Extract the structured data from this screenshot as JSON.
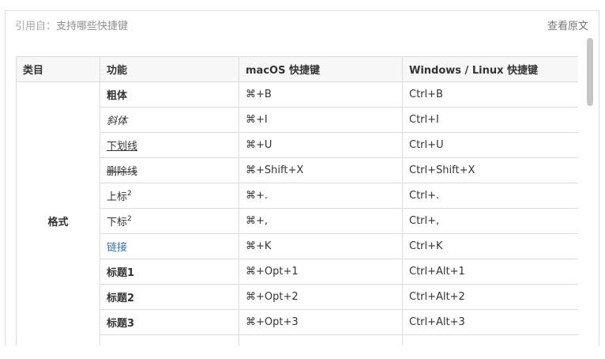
{
  "quote": {
    "prefix": "引用自：",
    "title": "支持哪些快捷键",
    "view_original": "查看原文"
  },
  "table": {
    "headers": [
      "类目",
      "功能",
      "macOS 快捷键",
      "Windows / Linux 快捷键"
    ],
    "category": "格式",
    "rows": [
      {
        "feature": "粗体",
        "style": "bold",
        "mac": "⌘+B",
        "win": "Ctrl+B"
      },
      {
        "feature": "斜体",
        "style": "italic",
        "mac": "⌘+I",
        "win": "Ctrl+I"
      },
      {
        "feature": "下划线",
        "style": "underline",
        "mac": "⌘+U",
        "win": "Ctrl+U"
      },
      {
        "feature": "删除线",
        "style": "strike",
        "mac": "⌘+Shift+X",
        "win": "Ctrl+Shift+X"
      },
      {
        "feature": "上标",
        "sup": "2",
        "style": "sup",
        "mac": "⌘+.",
        "win": "Ctrl+."
      },
      {
        "feature": "下标",
        "sup": "2",
        "style": "sub",
        "mac": "⌘+,",
        "win": "Ctrl+,"
      },
      {
        "feature": "链接",
        "style": "link",
        "mac": "⌘+K",
        "win": "Ctrl+K"
      },
      {
        "feature": "标题1",
        "style": "bold",
        "mac": "⌘+Opt+1",
        "win": "Ctrl+Alt+1"
      },
      {
        "feature": "标题2",
        "style": "bold",
        "mac": "⌘+Opt+2",
        "win": "Ctrl+Alt+2"
      },
      {
        "feature": "标题3",
        "style": "bold",
        "mac": "⌘+Opt+3",
        "win": "Ctrl+Alt+3"
      }
    ]
  },
  "colors": {
    "link": "#2f6fbf",
    "header_bg": "#f7f7f7",
    "border": "#dcdcdc"
  }
}
